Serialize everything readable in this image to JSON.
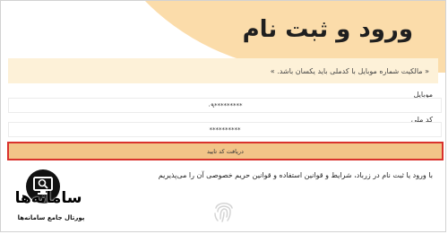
{
  "header": {
    "title": "ورود و ثبت نام"
  },
  "notice": {
    "text": "« مالکیت شماره موبایل با کدملی باید یکسان باشد. »"
  },
  "form": {
    "mobile_label": "موبایل",
    "mobile_value": "۰۹*********",
    "national_code_label": "کد ملی",
    "national_code_value": "**********",
    "submit_label": "دریافت کد تایید"
  },
  "terms": {
    "text": "با ورود یا ثبت نام در زرباد، شرایط و قوانین استفاده و قوانین حریم خصوصی آن را می‌پذیریم"
  },
  "watermark": {
    "brand": "سامانه‌ها",
    "tagline": "پورتال جامع سامانه‌ها",
    "icon": "monitor-search-icon"
  },
  "icons": {
    "fingerprint": "fingerprint-icon"
  },
  "colors": {
    "header_bg": "#fbdcaa",
    "notice_bg": "#fdf1d8",
    "button_bg": "#f2c488",
    "highlight_border": "#d9322d"
  }
}
